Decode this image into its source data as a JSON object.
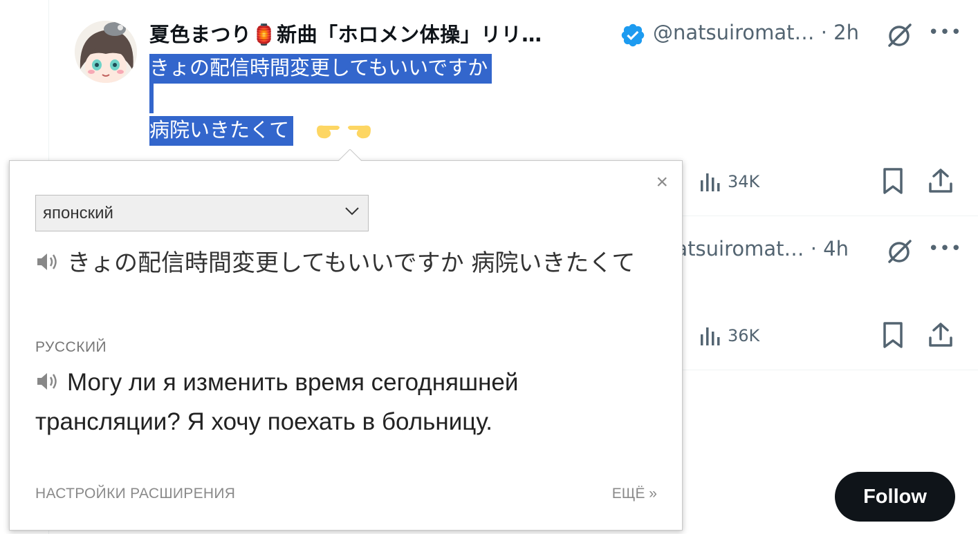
{
  "tweet1": {
    "author_name": "夏色まつり🏮新曲「ホロメン体操」リリ…",
    "handle": "@natsuiromat…",
    "time": "· 2h",
    "selected_text_lines": [
      "きょの配信時間変更してもいいですか",
      "",
      "病院いきたくて"
    ],
    "views": "34K"
  },
  "tweet2": {
    "handle_partial": "natsuiromat…",
    "time": "· 4h",
    "views": "36K"
  },
  "follow_label": "Follow",
  "translator": {
    "close_label": "×",
    "source_language": "японский",
    "source_text": "きょの配信時間変更してもいいですか 病院いきたくて",
    "target_language": "РУССКИЙ",
    "translation": "Могу ли я изменить время сегодняшней трансляции? Я хочу поехать в больницу.",
    "settings_link": "НАСТРОЙКИ РАСШИРЕНИЯ",
    "more_link": "ЕЩЁ »"
  },
  "colors": {
    "selection": "#3366cc",
    "verified": "#1d9bf0",
    "muted": "#536471",
    "follow_bg": "#0f1419"
  },
  "icons": [
    "verified-badge-icon",
    "grok-icon",
    "more-icon",
    "views-icon",
    "bookmark-icon",
    "share-icon",
    "speaker-icon",
    "chevron-down-icon",
    "close-icon",
    "lantern-emoji",
    "pointing-hands-emoji"
  ]
}
